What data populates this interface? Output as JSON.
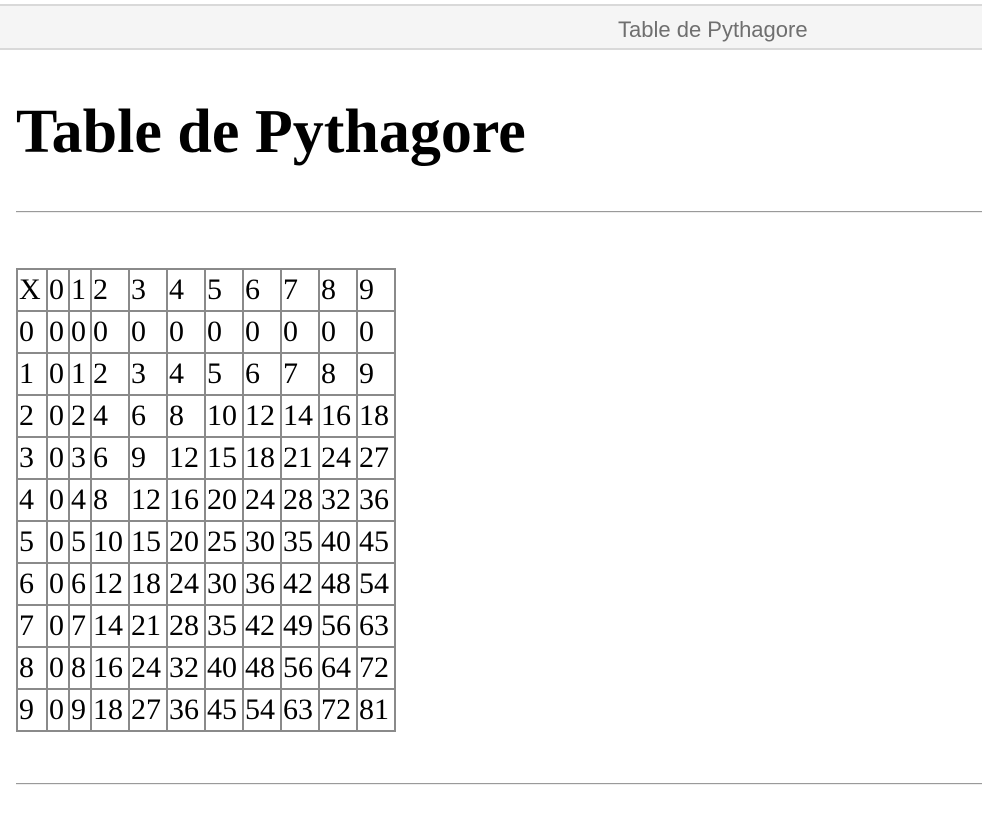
{
  "window": {
    "title": "Table de Pythagore"
  },
  "page": {
    "heading": "Table de Pythagore"
  },
  "table": {
    "header": [
      "X",
      "0",
      "1",
      "2",
      "3",
      "4",
      "5",
      "6",
      "7",
      "8",
      "9"
    ],
    "rows": [
      [
        "0",
        "0",
        "0",
        "0",
        "0",
        "0",
        "0",
        "0",
        "0",
        "0",
        "0"
      ],
      [
        "1",
        "0",
        "1",
        "2",
        "3",
        "4",
        "5",
        "6",
        "7",
        "8",
        "9"
      ],
      [
        "2",
        "0",
        "2",
        "4",
        "6",
        "8",
        "10",
        "12",
        "14",
        "16",
        "18"
      ],
      [
        "3",
        "0",
        "3",
        "6",
        "9",
        "12",
        "15",
        "18",
        "21",
        "24",
        "27"
      ],
      [
        "4",
        "0",
        "4",
        "8",
        "12",
        "16",
        "20",
        "24",
        "28",
        "32",
        "36"
      ],
      [
        "5",
        "0",
        "5",
        "10",
        "15",
        "20",
        "25",
        "30",
        "35",
        "40",
        "45"
      ],
      [
        "6",
        "0",
        "6",
        "12",
        "18",
        "24",
        "30",
        "36",
        "42",
        "48",
        "54"
      ],
      [
        "7",
        "0",
        "7",
        "14",
        "21",
        "28",
        "35",
        "42",
        "49",
        "56",
        "63"
      ],
      [
        "8",
        "0",
        "8",
        "16",
        "24",
        "32",
        "40",
        "48",
        "56",
        "64",
        "72"
      ],
      [
        "9",
        "0",
        "9",
        "18",
        "27",
        "36",
        "45",
        "54",
        "63",
        "72",
        "81"
      ]
    ]
  }
}
